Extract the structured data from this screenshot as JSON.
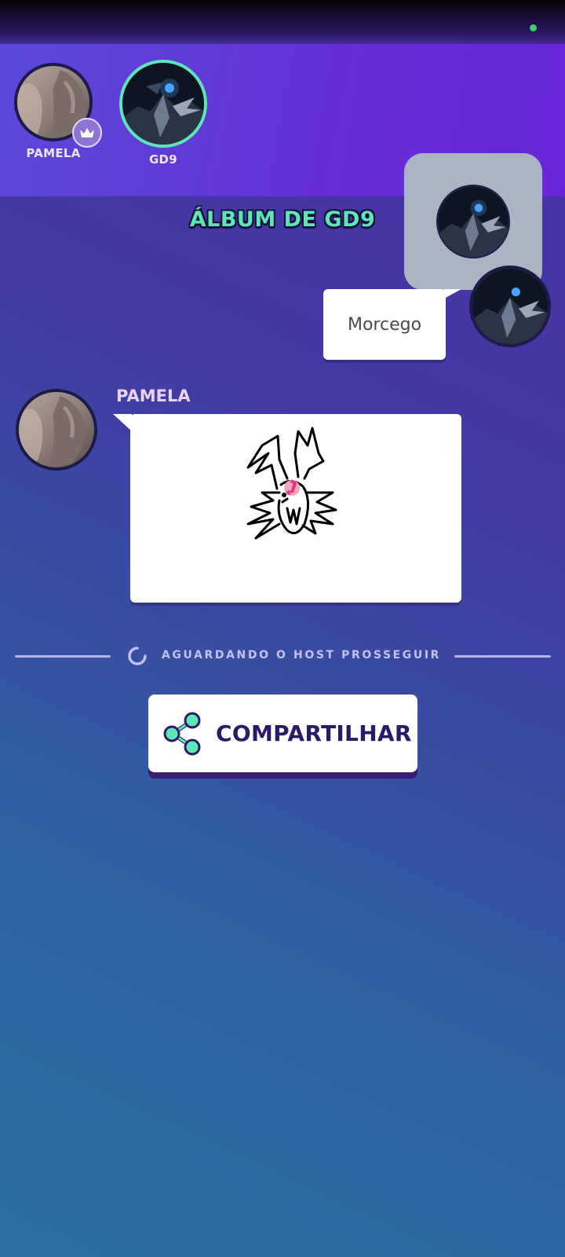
{
  "colors": {
    "accent_green": "#5de6b6",
    "status_dot": "#3ed06b",
    "host_crown_badge": "#8e74d4",
    "button_text": "#2b1a68"
  },
  "players": [
    {
      "name": "PAMELA",
      "is_host": true,
      "avatar": "pamela-photo-avatar",
      "badge_icon": "crown-icon"
    },
    {
      "name": "GD9",
      "is_host": false,
      "avatar": "gd9-dark-knight-avatar",
      "active": true
    }
  ],
  "album": {
    "title": "ÁLBUM DE GD9"
  },
  "chat": {
    "guess_text": "Morcego",
    "drawer_name": "PAMELA",
    "drawing": "doodle-drawing"
  },
  "status": {
    "waiting_text": "AGUARDANDO O HOST PROSSEGUIR"
  },
  "share": {
    "label": "COMPARTILHAR",
    "icon": "share-icon"
  }
}
